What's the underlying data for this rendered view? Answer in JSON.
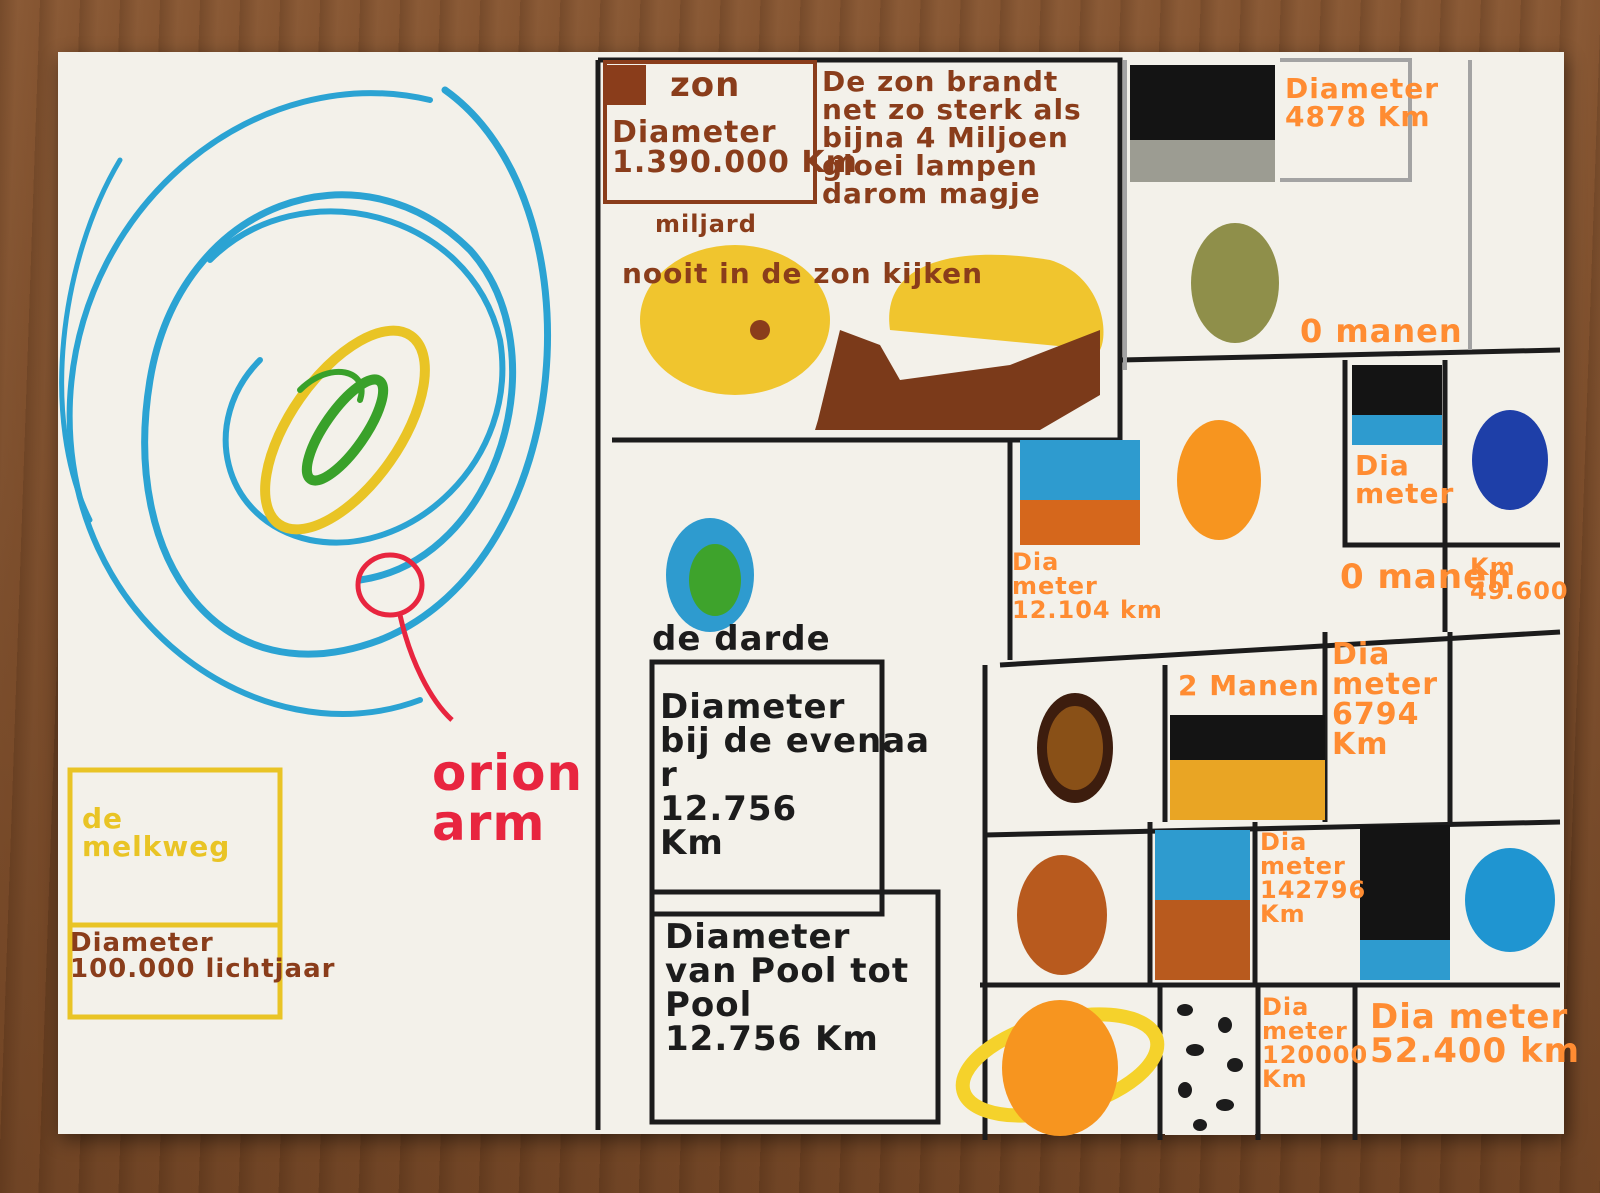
{
  "galaxy": {
    "pointer_label": "orion\narm",
    "name_label": "de\nmelkweg",
    "diameter_label": "Diameter\n100.000 lichtjaar"
  },
  "sun": {
    "name": "zon",
    "diameter": "Diameter\n1.390.000 Km",
    "fact": "De zon brandt\nnet zo sterk als\nbijna 4 Miljoen\ngloei lampen\ndarom magje",
    "miljard": "miljard",
    "warning": "nooit in de zon kijken"
  },
  "earth": {
    "name": "de darde",
    "equator": "Diameter\nbij de evenaa\nr\n12.756\nKm",
    "poles": "Diameter\nvan Pool tot\nPool\n12.756 Km"
  },
  "mercury": {
    "diameter": "Diameter\n4878 Km",
    "moons": "0 manen"
  },
  "venus": {
    "diameter": "Dia\nmeter\n12.104 km"
  },
  "neptune": {
    "diameter": "Dia\nmeter",
    "moons": "0 manen",
    "km": "Km\n49.600"
  },
  "mars": {
    "moons": "2 Manen",
    "diameter": "Dia\nmeter\n6794\nKm"
  },
  "jupiter": {
    "diameter": "Dia\nmeter\n142796\nKm"
  },
  "saturn": {
    "diameter": "Dia\nmeter\n120000\nKm"
  },
  "uranus": {
    "diameter": "Dia meter\n52.400 km"
  }
}
